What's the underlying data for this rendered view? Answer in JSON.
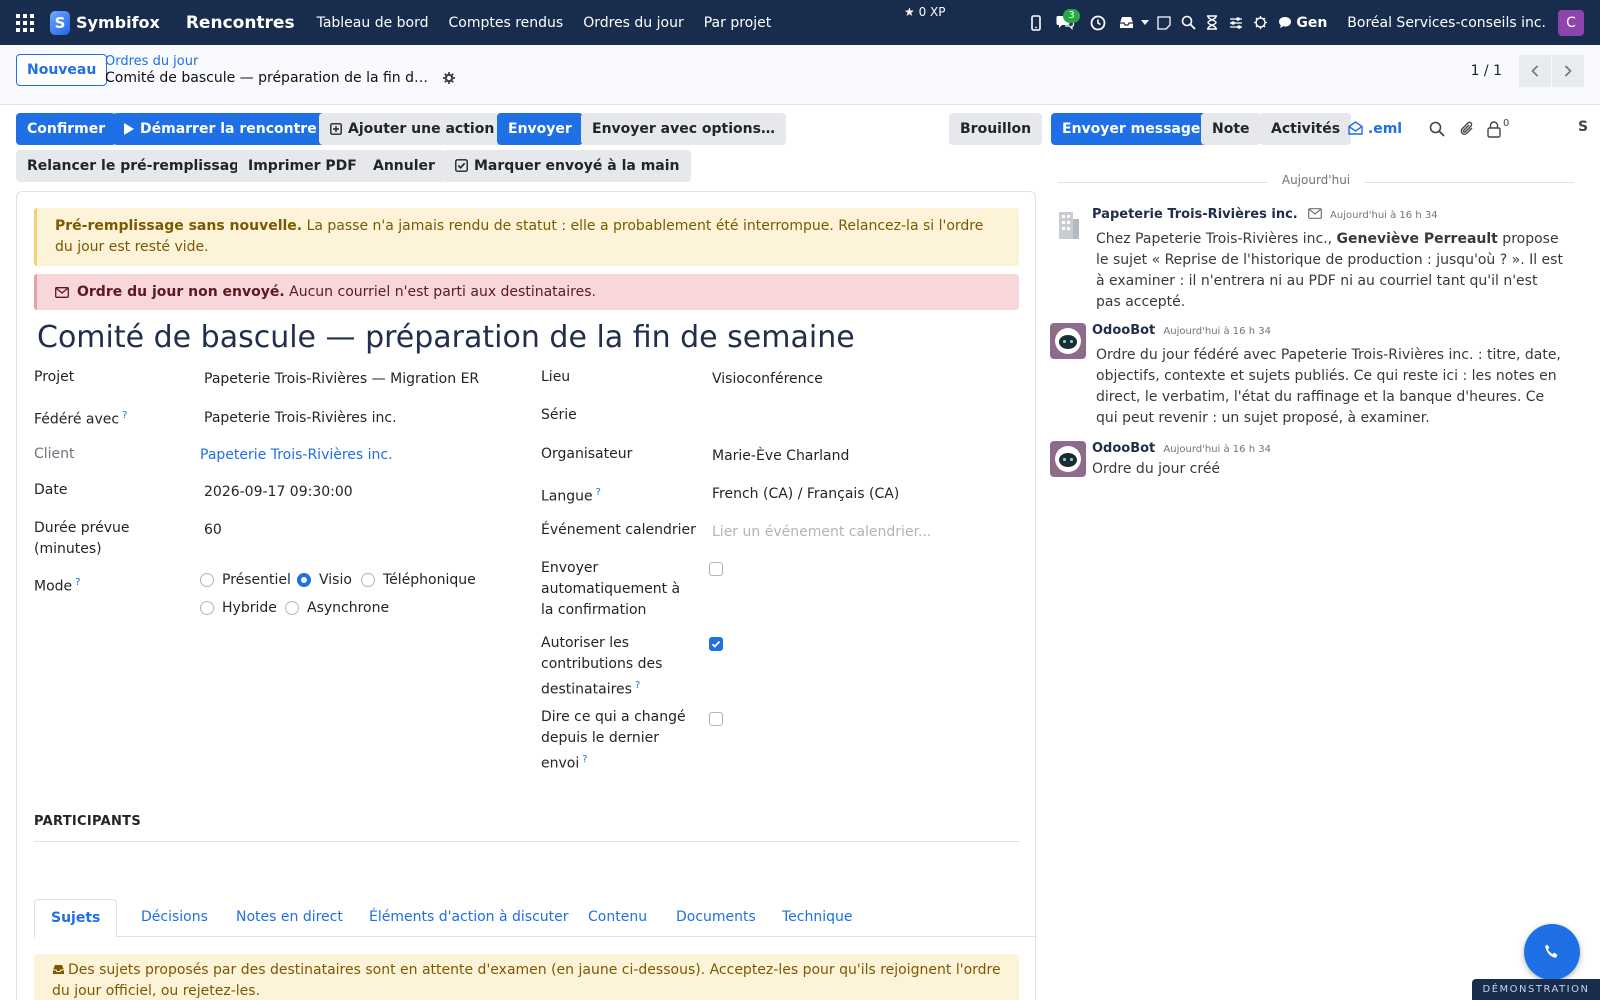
{
  "navbar": {
    "brand": "Symbifox",
    "brand_initial": "S",
    "app_name": "Rencontres",
    "links": [
      "Tableau de bord",
      "Comptes rendus",
      "Ordres du jour",
      "Par projet"
    ],
    "xp": "0 XP",
    "chat_badge": "3",
    "gen_label": "Gen",
    "company": "Boréal Services-conseils inc.",
    "user_initial": "C"
  },
  "control_panel": {
    "new_button": "Nouveau",
    "breadcrumb_parent": "Ordres du jour",
    "breadcrumb_current": "Comité de bascule — préparation de la fin de semaine",
    "pager_value": "1 / 1"
  },
  "toolbar": {
    "confirm": "Confirmer",
    "start_meeting": "Démarrer la rencontre",
    "add_action": "Ajouter une action",
    "send": "Envoyer",
    "send_options": "Envoyer avec options…",
    "status_draft": "Brouillon",
    "rerun_prefill": "Relancer le pré-remplissage",
    "print_pdf": "Imprimer PDF",
    "cancel": "Annuler",
    "mark_sent": "Marquer envoyé à la main"
  },
  "alerts": {
    "prefill_title": "Pré-remplissage sans nouvelle.",
    "prefill_text": " La passe n'a jamais rendu de statut : elle a probablement été interrompue. Relancez-la si l'ordre du jour est resté vide.",
    "not_sent_title": "Ordre du jour non envoyé.",
    "not_sent_text": " Aucun courriel n'est parti aux destinataires."
  },
  "record": {
    "title": "Comité de bascule — préparation de la fin de semaine"
  },
  "fields": {
    "project_label": "Projet",
    "project_value": "Papeterie Trois-Rivières — Migration ERP",
    "federated_label": "Fédéré avec",
    "federated_value": "Papeterie Trois-Rivières inc.",
    "client_label": "Client",
    "client_value": "Papeterie Trois-Rivières inc.",
    "date_label": "Date",
    "date_value": "2026-09-17 09:30:00",
    "duration_label": "Durée prévue (minutes)",
    "duration_value": "60",
    "mode_label": "Mode",
    "mode_options": [
      "Présentiel",
      "Visio",
      "Téléphonique",
      "Hybride",
      "Asynchrone"
    ],
    "mode_selected": "Visio",
    "location_label": "Lieu",
    "location_value": "Visioconférence",
    "series_label": "Série",
    "organizer_label": "Organisateur",
    "organizer_value": "Marie-Ève Charland",
    "language_label": "Langue",
    "language_value": "French (CA) / Français (CA)",
    "calendar_label": "Événement calendrier",
    "calendar_placeholder": "Lier un événement calendrier...",
    "auto_send_label": "Envoyer automatiquement à la confirmation",
    "auto_send_checked": false,
    "allow_contrib_label": "Autoriser les contributions des destinataires",
    "allow_contrib_checked": true,
    "changes_label": "Dire ce qui a changé depuis le dernier envoi",
    "changes_checked": false,
    "help_mark": "?"
  },
  "participants_title": "PARTICIPANTS",
  "tabs": [
    "Sujets",
    "Décisions",
    "Notes en direct",
    "Éléments d'action à discuter",
    "Contenu",
    "Documents",
    "Technique"
  ],
  "active_tab": "Sujets",
  "tab_alert": "Des sujets proposés par des destinataires sont en attente d'examen (en jaune ci-dessous). Acceptez-les pour qu'ils rejoignent l'ordre du jour officiel, ou rejetez-les.",
  "chatter": {
    "send_message": "Envoyer message",
    "note": "Note",
    "activities": "Activités",
    "eml": ".eml",
    "follower_count": "0",
    "follow_label": "S",
    "today": "Aujourd'hui",
    "messages": [
      {
        "author": "Papeterie Trois-Rivières inc.",
        "date": "Aujourd'hui à 16 h 34",
        "body_prefix": "Chez Papeterie Trois-Rivières inc., ",
        "body_bold": "Geneviève Perreault",
        "body_suffix": " propose le sujet « Reprise de l'historique de production : jusqu'où ? ». Il est à examiner : il n'entrera ni au PDF ni au courriel tant qu'il n'est pas accepté."
      },
      {
        "author": "OdooBot",
        "date": "Aujourd'hui à 16 h 34",
        "body": "Ordre du jour fédéré avec Papeterie Trois-Rivières inc. : titre, date, objectifs, contexte et sujets publiés. Ce qui reste ici : les notes en direct, le verbatim, l'état du raffinage et la banque d'heures. Ce qui peut revenir : un sujet proposé, à examiner."
      },
      {
        "author": "OdooBot",
        "date": "Aujourd'hui à 16 h 34",
        "body": "Ordre du jour créé"
      }
    ]
  },
  "demo_ribbon": "DÉMONSTRATION",
  "colors": {
    "navbar": "#182c4d",
    "primary": "#1f6fe5",
    "warning_bg": "#fdf3d8",
    "danger_bg": "#f8d7da"
  }
}
